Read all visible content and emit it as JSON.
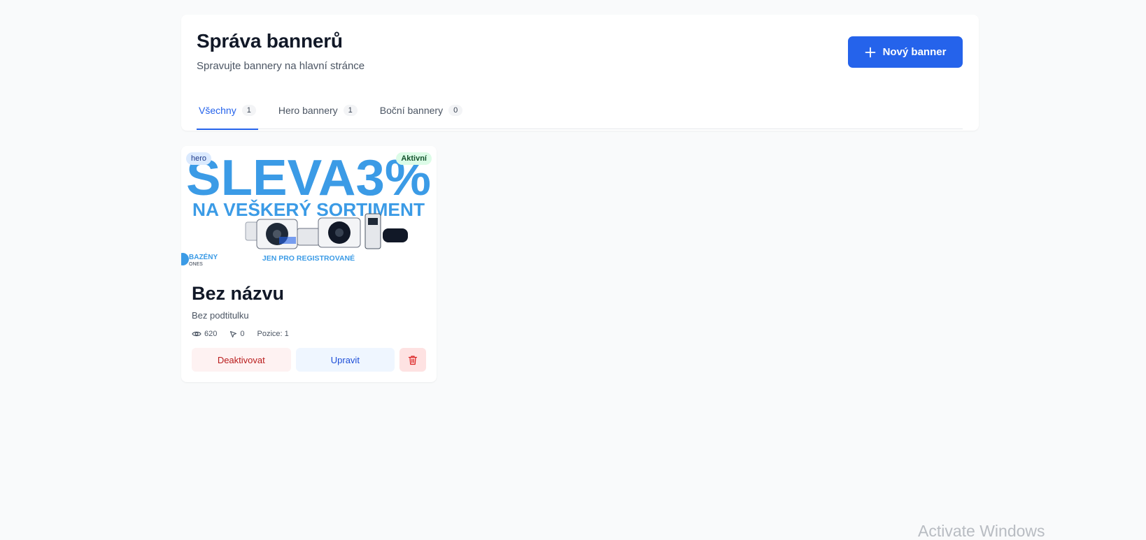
{
  "header": {
    "title": "Správa bannerů",
    "subtitle": "Spravujte bannery na hlavní stránce",
    "new_button_label": "Nový banner"
  },
  "tabs": [
    {
      "label": "Všechny",
      "count": "1",
      "active": true
    },
    {
      "label": "Hero bannery",
      "count": "1",
      "active": false
    },
    {
      "label": "Boční bannery",
      "count": "0",
      "active": false
    }
  ],
  "banners": [
    {
      "type": "hero",
      "status": "Aktivní",
      "image": {
        "headline": "SLEVA3%",
        "line2": "NA VEŠKERÝ SORTIMENT",
        "footer": "JEN PRO REGISTROVANÉ",
        "logo": "BAZÉNY",
        "logo_sub": "ONES"
      },
      "title": "Bez názvu",
      "subtitle": "Bez podtitulku",
      "views": "620",
      "clicks": "0",
      "position": "Pozice: 1",
      "deactivate_label": "Deaktivovat",
      "edit_label": "Upravit"
    }
  ],
  "colors": {
    "primary": "#2563eb",
    "banner_blue": "#3b9be6",
    "danger": "#dc2626",
    "active_badge": "#dcfce7"
  },
  "icons": {
    "new_button": "plus-icon",
    "views": "eye-icon",
    "clicks": "cursor-icon",
    "delete": "trash-icon"
  },
  "os_watermark": "Activate Windows"
}
